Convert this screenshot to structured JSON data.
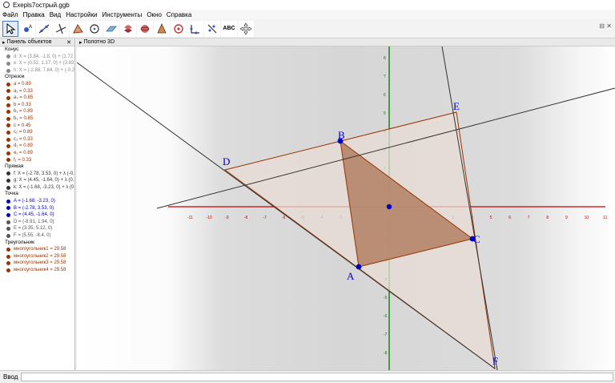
{
  "window": {
    "title": "Ехерls7острый.ggb"
  },
  "menu": [
    "Файл",
    "Правка",
    "Вид",
    "Настройки",
    "Инструменты",
    "Окно",
    "Справка"
  ],
  "toolbar": {
    "abc_label": "ABC"
  },
  "algebra": {
    "title": "Панель объектов",
    "groups": [
      {
        "header": "Конус",
        "items": [
          {
            "text": "d: X = (3.84, -1.8, 0) + (1.72 c",
            "color": "#888888"
          },
          {
            "text": "e: X = (0.52, 1.17, 0) + (3.83 -",
            "color": "#888888"
          },
          {
            "text": "h: X = (-2.88, 7.84, 0) + (-0.2.",
            "color": "#888888"
          }
        ]
      },
      {
        "header": "Отрезок",
        "items": [
          {
            "text": "a = 0.89",
            "color": "#993300"
          },
          {
            "text": "a₁ = 0.33",
            "color": "#993300"
          },
          {
            "text": "a₂ = 0.85",
            "color": "#993300"
          },
          {
            "text": "b = 0.33",
            "color": "#993300"
          },
          {
            "text": "b₁ = 0.89",
            "color": "#993300"
          },
          {
            "text": "b₂ = 0.85",
            "color": "#993300"
          },
          {
            "text": "c = 0.45",
            "color": "#993300"
          },
          {
            "text": "c₁ = 0.89",
            "color": "#993300"
          },
          {
            "text": "c₂ = 0.33",
            "color": "#993300"
          },
          {
            "text": "d₁ = 0.89",
            "color": "#993300"
          },
          {
            "text": "e₁ = 0.89",
            "color": "#993300"
          },
          {
            "text": "f₁ = 0.33",
            "color": "#993300"
          }
        ]
      },
      {
        "header": "Прямая",
        "items": [
          {
            "text": "f: X = (-2.78, 3.53, 0) + λ (-0.1",
            "color": "#333333"
          },
          {
            "text": "g: X = (4.45, -1.64, 0) + λ (0.",
            "color": "#333333"
          },
          {
            "text": "k: X = (-1.68, -3.23, 0) + λ (0.",
            "color": "#333333"
          }
        ]
      },
      {
        "header": "Точка",
        "items": [
          {
            "text": "A = (-1.68, -3.23, 0)",
            "color": "#0000cc"
          },
          {
            "text": "B = (-2.78, 3.53, 0)",
            "color": "#0000cc"
          },
          {
            "text": "C = (4.45, -1.64, 0)",
            "color": "#0000cc"
          },
          {
            "text": "D = (-8.91, 1.94, 0)",
            "color": "#555555"
          },
          {
            "text": "E = (3.35, 5.12, 0)",
            "color": "#555555"
          },
          {
            "text": "F = (5.55, -8.4, 0)",
            "color": "#555555"
          }
        ]
      },
      {
        "header": "Треугольник",
        "items": [
          {
            "text": "многоугольник1 = 29.58",
            "color": "#993300"
          },
          {
            "text": "многоугольник2 = 29.58",
            "color": "#993300"
          },
          {
            "text": "многоугольник3 = 29.58",
            "color": "#993300"
          },
          {
            "text": "многоугольник4 = 29.58",
            "color": "#993300"
          }
        ]
      }
    ]
  },
  "graphics": {
    "title": "Полотно 3D",
    "x_ticks": [
      "-11",
      "-10",
      "-9",
      "-8",
      "-7",
      "-6",
      "-5",
      "-4",
      "-3",
      "-2",
      "-1",
      "1",
      "2",
      "3",
      "4",
      "5",
      "6",
      "7",
      "8",
      "9",
      "10",
      "11"
    ],
    "y_ticks": [
      "8",
      "7",
      "6",
      "5",
      "4",
      "3",
      "2",
      "1",
      "-1",
      "-2",
      "-3",
      "-4",
      "-5",
      "-6",
      "-7",
      "-8"
    ],
    "points": {
      "A": "A",
      "B": "B",
      "C": "C",
      "D": "D",
      "E": "E",
      "F": "F"
    },
    "colors": {
      "triangle_fill": "#b5846a",
      "outer_fill": "#e8dcd6",
      "edge": "#993300",
      "x_axis": "#cc0000",
      "y_axis": "#008800",
      "point": "#0000cc"
    }
  },
  "status": {
    "input_label": "Ввод"
  }
}
